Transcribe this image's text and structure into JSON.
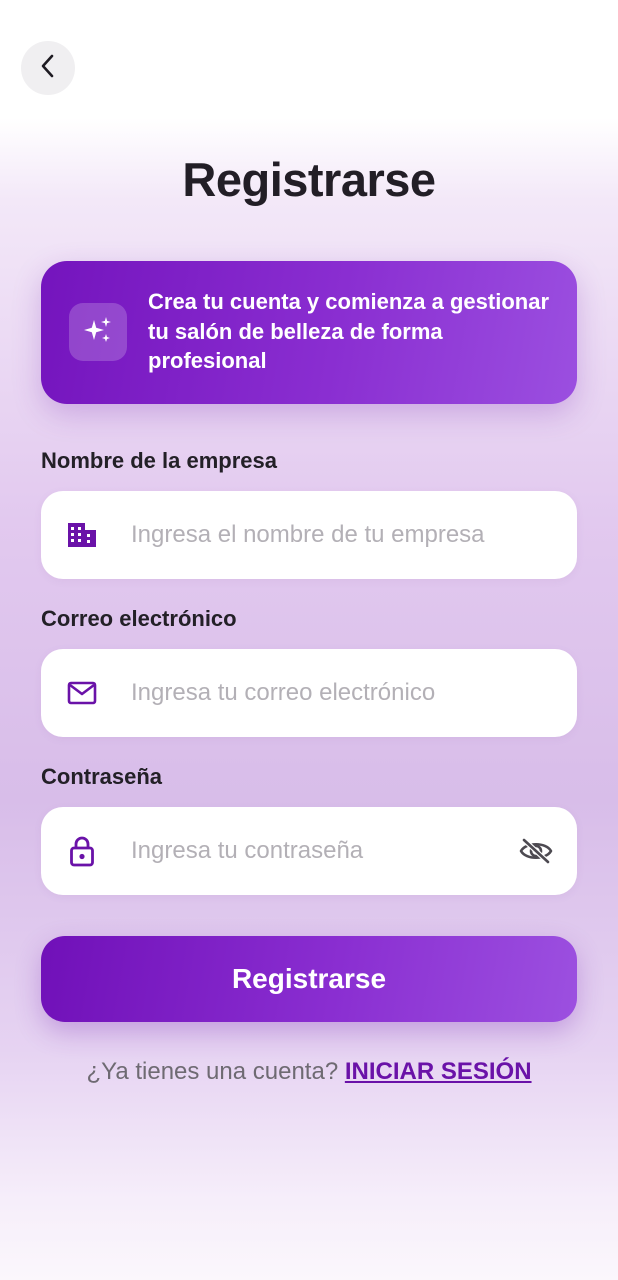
{
  "header": {
    "back_icon": "chevron-left-icon"
  },
  "page": {
    "title": "Registrarse"
  },
  "banner": {
    "icon": "sparkles-icon",
    "text": "Crea tu cuenta y comienza a gestionar tu salón de belleza de forma profesional"
  },
  "form": {
    "company": {
      "label": "Nombre de la empresa",
      "placeholder": "Ingresa el nombre de tu empresa",
      "value": "",
      "icon": "building-icon"
    },
    "email": {
      "label": "Correo electrónico",
      "placeholder": "Ingresa tu correo electrónico",
      "value": "",
      "icon": "mail-icon"
    },
    "password": {
      "label": "Contraseña",
      "placeholder": "Ingresa tu contraseña",
      "value": "",
      "icon": "lock-icon",
      "toggle_icon": "eye-off-icon"
    },
    "submit_label": "Registrarse"
  },
  "footer": {
    "prompt": "¿Ya tienes una cuenta?",
    "link_label": "INICIAR SESIÓN"
  },
  "colors": {
    "accent": "#7414bd",
    "accent_light": "#9b4fe0",
    "icon": "#6a12a8",
    "link": "#6a12a8"
  }
}
